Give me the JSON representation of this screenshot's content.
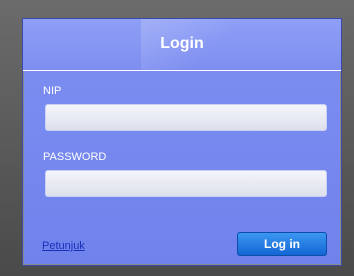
{
  "login": {
    "title": "Login",
    "nip_label": "NIP",
    "nip_value": "",
    "password_label": "PASSWORD",
    "password_value": "",
    "help_link": "Petunjuk",
    "submit_label": "Log in"
  },
  "colors": {
    "panel": "#7889ef",
    "button": "#1e78e0",
    "link": "#1a2fb8"
  }
}
